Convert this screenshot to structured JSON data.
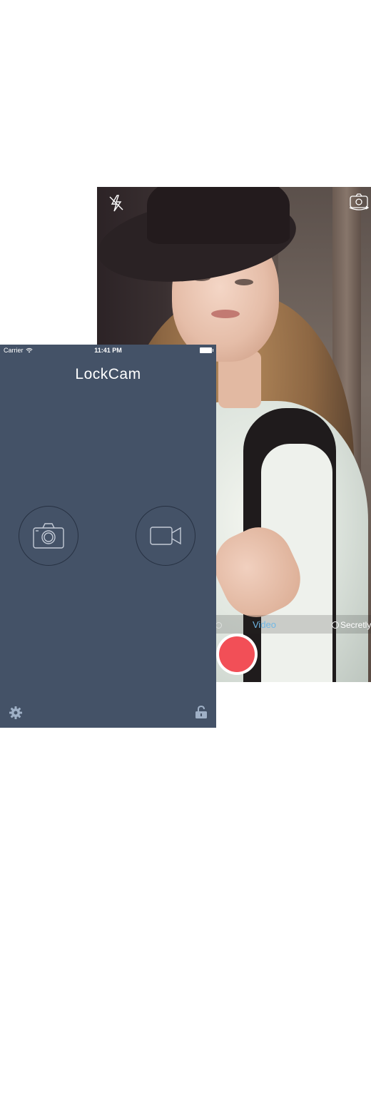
{
  "camera_view": {
    "flash_icon": "flash-off-icon",
    "switch_camera_icon": "switch-camera-icon",
    "modes": {
      "video_label": "Video",
      "secretly_label": "Secretly"
    },
    "shutter_color": "#f24f57",
    "active_mode_color": "#6fb7e6"
  },
  "lockcam": {
    "status_bar": {
      "carrier": "Carrier",
      "time": "11:41 PM"
    },
    "title": "LockCam",
    "background_color": "#445267",
    "photo_button_icon": "camera-icon",
    "video_button_icon": "video-camera-icon",
    "settings_icon": "gear-icon",
    "lock_icon": "unlocked-padlock-icon"
  }
}
